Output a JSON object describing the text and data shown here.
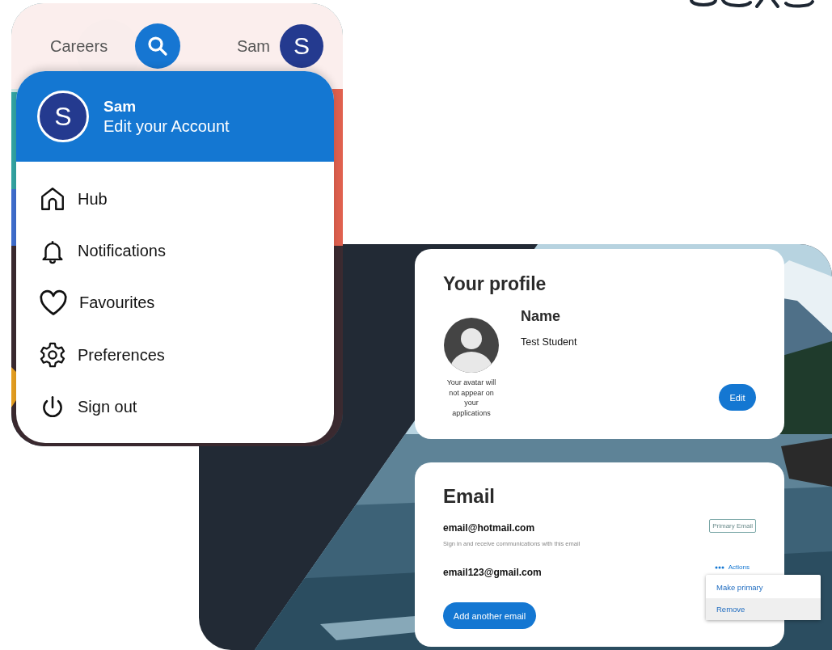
{
  "top_bar": {
    "link": "Careers",
    "user_name": "Sam",
    "avatar_letter": "S"
  },
  "account_menu": {
    "avatar_letter": "S",
    "name": "Sam",
    "subtitle": "Edit your Account",
    "items": [
      {
        "label": "Hub",
        "kind": "home"
      },
      {
        "label": "Notifications",
        "kind": "bell"
      },
      {
        "label": "Favourites",
        "kind": "heart"
      },
      {
        "label": "Preferences",
        "kind": "gear"
      },
      {
        "label": "Sign out",
        "kind": "power"
      }
    ]
  },
  "profile": {
    "title": "Your profile",
    "avatar_caption": "Your avatar will not appear on your applications",
    "name_label": "Name",
    "name_value": "Test Student",
    "edit_button": "Edit"
  },
  "email": {
    "title": "Email",
    "addresses": [
      {
        "address": "email@hotmail.com",
        "note": "Sign in and receive communications with this email",
        "primary": true,
        "badge": "Primary Email"
      },
      {
        "address": "email123@gmail.com",
        "primary": false,
        "actions": "Actions"
      }
    ],
    "actions_menu": [
      {
        "label": "Make primary",
        "highlighted": false
      },
      {
        "label": "Remove",
        "highlighted": true
      }
    ],
    "add_button": "Add another email"
  }
}
